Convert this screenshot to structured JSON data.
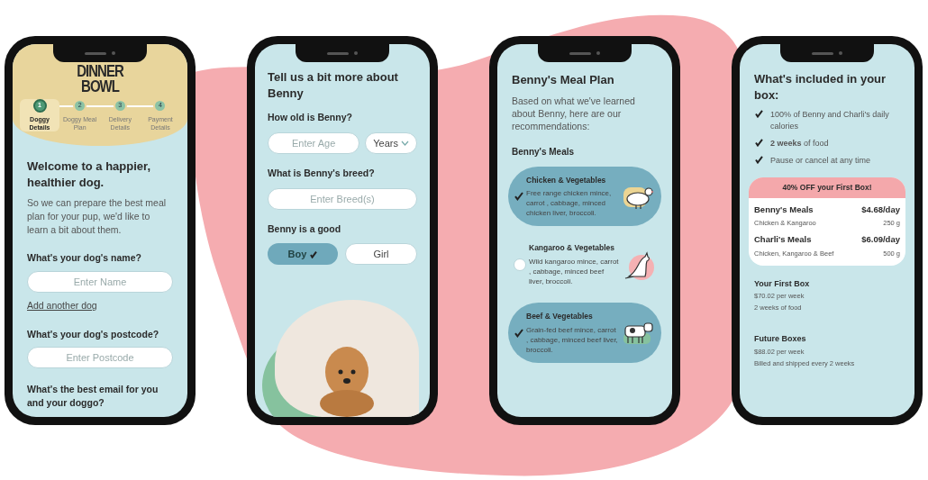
{
  "screens": [
    {
      "kind": "onboarding",
      "logo": [
        "DINNER",
        "BOWL"
      ],
      "steps": [
        {
          "number": "1",
          "label": "Doggy Details",
          "selected": true
        },
        {
          "number": "2",
          "label": "Doggy Meal Plan",
          "selected": false
        },
        {
          "number": "3",
          "label": "Delivery Details",
          "selected": false
        },
        {
          "number": "4",
          "label": "Payment Details",
          "selected": false
        }
      ],
      "heading": "Welcome to a happier, healthier dog.",
      "intro": "So we can prepare the best meal plan for your pup, we'd like to learn a bit about them.",
      "name_question": "What's your dog's name?",
      "name_field": {
        "placeholder": "Enter Name"
      },
      "add_link": "Add another dog",
      "postcode_question": "What's your dog's postcode?",
      "postcode_field": {
        "placeholder": "Enter Postcode"
      },
      "email_question": "What's the best email for you and your doggo?"
    },
    {
      "kind": "details",
      "heading": "Tell us a bit more about Benny",
      "age_question": "How old is Benny?",
      "age_field": {
        "placeholder": "Enter Age"
      },
      "unit_dropdown": "Years",
      "breed_question": "What is Benny's breed?",
      "breed_field": {
        "placeholder": "Enter Breed(s)"
      },
      "gender_question": "Benny is a good",
      "options": [
        {
          "label": "Boy",
          "selected": true
        },
        {
          "label": "Girl",
          "selected": false
        }
      ]
    },
    {
      "kind": "meal_plan",
      "heading": "Benny's Meal Plan",
      "intro": "Based on what we've learned about Benny, here are our recommendations:",
      "section": "Benny's Meals",
      "meals": [
        {
          "name": "Chicken & Vegetables",
          "description": "Free range chicken mince, carrot , cabbage, minced chicken liver, broccoli.",
          "selected": true
        },
        {
          "name": "Kangaroo & Vegetables",
          "description": "Wild kangaroo mince, carrot , cabbage, minced beef liver, broccoli.",
          "selected": false
        },
        {
          "name": "Beef & Vegetables",
          "description": "Grain-fed beef mince, carrot , cabbage, minced beef liver, broccoli.",
          "selected": true
        }
      ]
    },
    {
      "kind": "summary",
      "heading": "What's included in your box:",
      "included": [
        "100% of Benny and Charli's daily calories",
        "**2 weeks** of food",
        "Pause or cancel at any time"
      ],
      "promo": "40% OFF your First Box!",
      "plans": [
        {
          "name": "Benny's Meals",
          "price": "$4.68/day",
          "detail": "Chicken & Kangaroo",
          "weight": "250 g"
        },
        {
          "name": "Charli's Meals",
          "price": "$6.09/day",
          "detail": "Chicken, Kangaroo & Beef",
          "weight": "500 g"
        }
      ],
      "boxes": [
        {
          "title": "Your First Box",
          "lines": [
            "$70.02 per week",
            "2 weeks of food"
          ]
        },
        {
          "title": "Future Boxes",
          "lines": [
            "$88.02 per week",
            "Billed and shipped every 2 weeks"
          ]
        }
      ]
    }
  ]
}
